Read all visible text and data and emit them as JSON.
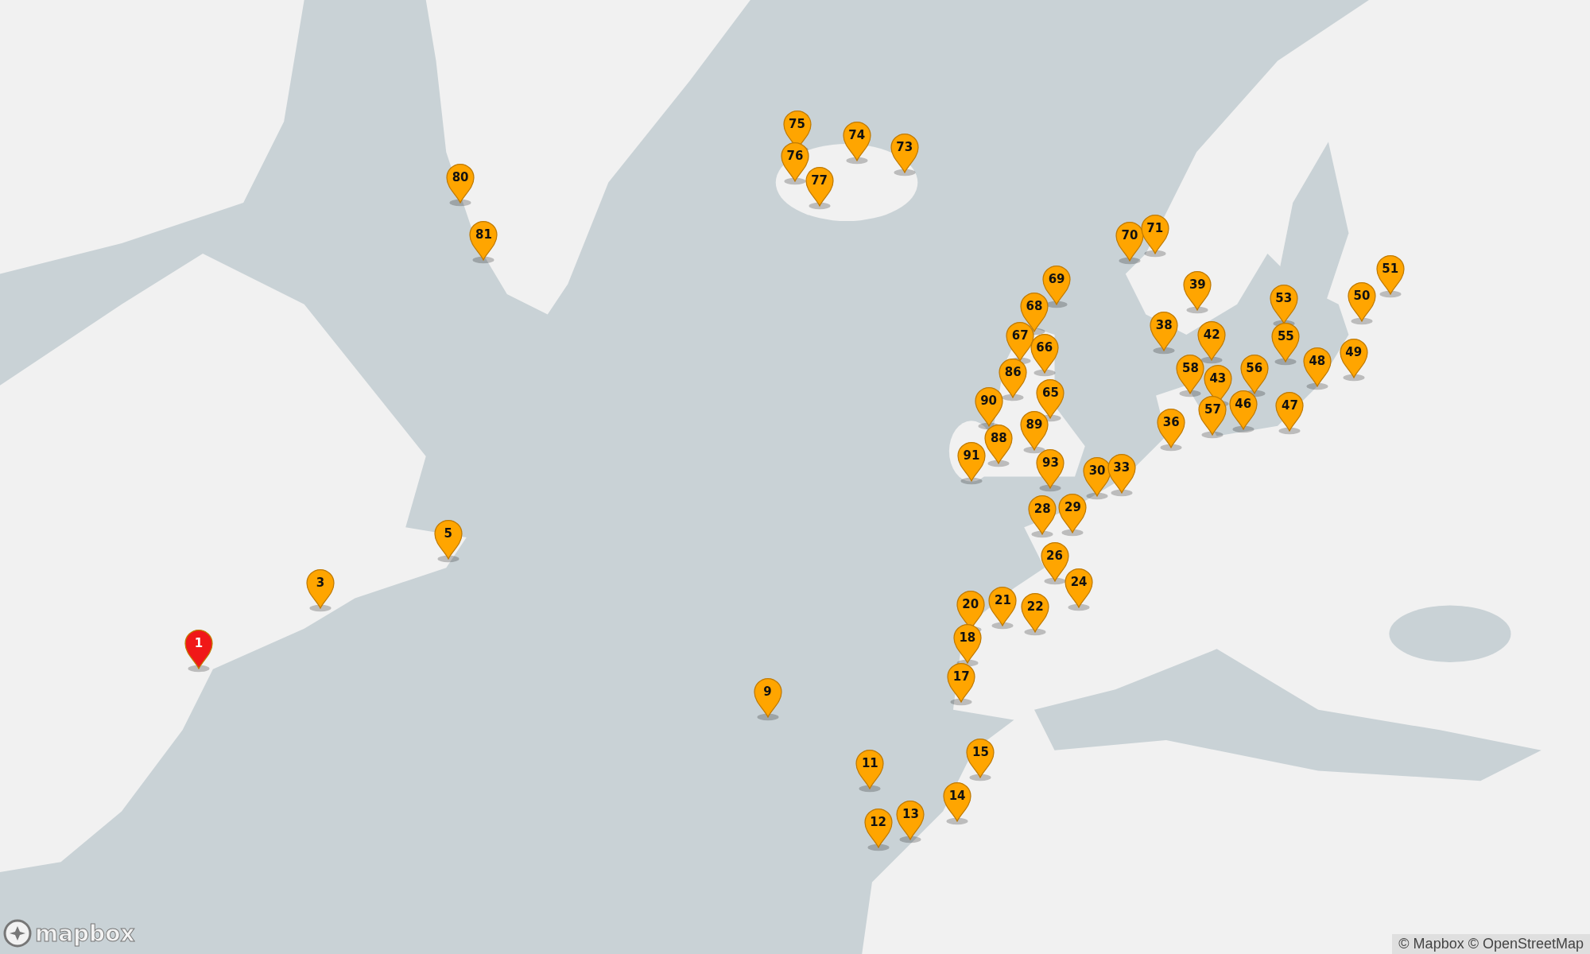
{
  "markers": [
    {
      "label": "75",
      "color": "#ffa500"
    },
    {
      "label": "74",
      "color": "#ffa500"
    },
    {
      "label": "73",
      "color": "#ffa500"
    },
    {
      "label": "76",
      "color": "#ffa500"
    },
    {
      "label": "80",
      "color": "#ffa500"
    },
    {
      "label": "77",
      "color": "#ffa500"
    },
    {
      "label": "81",
      "color": "#ffa500"
    },
    {
      "label": "70",
      "color": "#ffa500"
    },
    {
      "label": "71",
      "color": "#ffa500"
    },
    {
      "label": "51",
      "color": "#ffa500"
    },
    {
      "label": "69",
      "color": "#ffa500"
    },
    {
      "label": "39",
      "color": "#ffa500"
    },
    {
      "label": "53",
      "color": "#ffa500"
    },
    {
      "label": "50",
      "color": "#ffa500"
    },
    {
      "label": "68",
      "color": "#ffa500"
    },
    {
      "label": "38",
      "color": "#ffa500"
    },
    {
      "label": "67",
      "color": "#ffa500"
    },
    {
      "label": "42",
      "color": "#ffa500"
    },
    {
      "label": "55",
      "color": "#ffa500"
    },
    {
      "label": "66",
      "color": "#ffa500"
    },
    {
      "label": "49",
      "color": "#ffa500"
    },
    {
      "label": "48",
      "color": "#ffa500"
    },
    {
      "label": "86",
      "color": "#ffa500"
    },
    {
      "label": "58",
      "color": "#ffa500"
    },
    {
      "label": "56",
      "color": "#ffa500"
    },
    {
      "label": "43",
      "color": "#ffa500"
    },
    {
      "label": "90",
      "color": "#ffa500"
    },
    {
      "label": "65",
      "color": "#ffa500"
    },
    {
      "label": "46",
      "color": "#ffa500"
    },
    {
      "label": "57",
      "color": "#ffa500"
    },
    {
      "label": "47",
      "color": "#ffa500"
    },
    {
      "label": "88",
      "color": "#ffa500"
    },
    {
      "label": "89",
      "color": "#ffa500"
    },
    {
      "label": "36",
      "color": "#ffa500"
    },
    {
      "label": "91",
      "color": "#ffa500"
    },
    {
      "label": "93",
      "color": "#ffa500"
    },
    {
      "label": "30",
      "color": "#ffa500"
    },
    {
      "label": "33",
      "color": "#ffa500"
    },
    {
      "label": "28",
      "color": "#ffa500"
    },
    {
      "label": "29",
      "color": "#ffa500"
    },
    {
      "label": "5",
      "color": "#ffa500"
    },
    {
      "label": "26",
      "color": "#ffa500"
    },
    {
      "label": "3",
      "color": "#ffa500"
    },
    {
      "label": "24",
      "color": "#ffa500"
    },
    {
      "label": "20",
      "color": "#ffa500"
    },
    {
      "label": "21",
      "color": "#ffa500"
    },
    {
      "label": "22",
      "color": "#ffa500"
    },
    {
      "label": "1",
      "color": "#f01818"
    },
    {
      "label": "18",
      "color": "#ffa500"
    },
    {
      "label": "17",
      "color": "#ffa500"
    },
    {
      "label": "9",
      "color": "#ffa500"
    },
    {
      "label": "15",
      "color": "#ffa500"
    },
    {
      "label": "11",
      "color": "#ffa500"
    },
    {
      "label": "14",
      "color": "#ffa500"
    },
    {
      "label": "12",
      "color": "#ffa500"
    },
    {
      "label": "13",
      "color": "#ffa500"
    }
  ],
  "logo": {
    "text": "mapbox"
  },
  "attribution": "© Mapbox © OpenStreetMap"
}
